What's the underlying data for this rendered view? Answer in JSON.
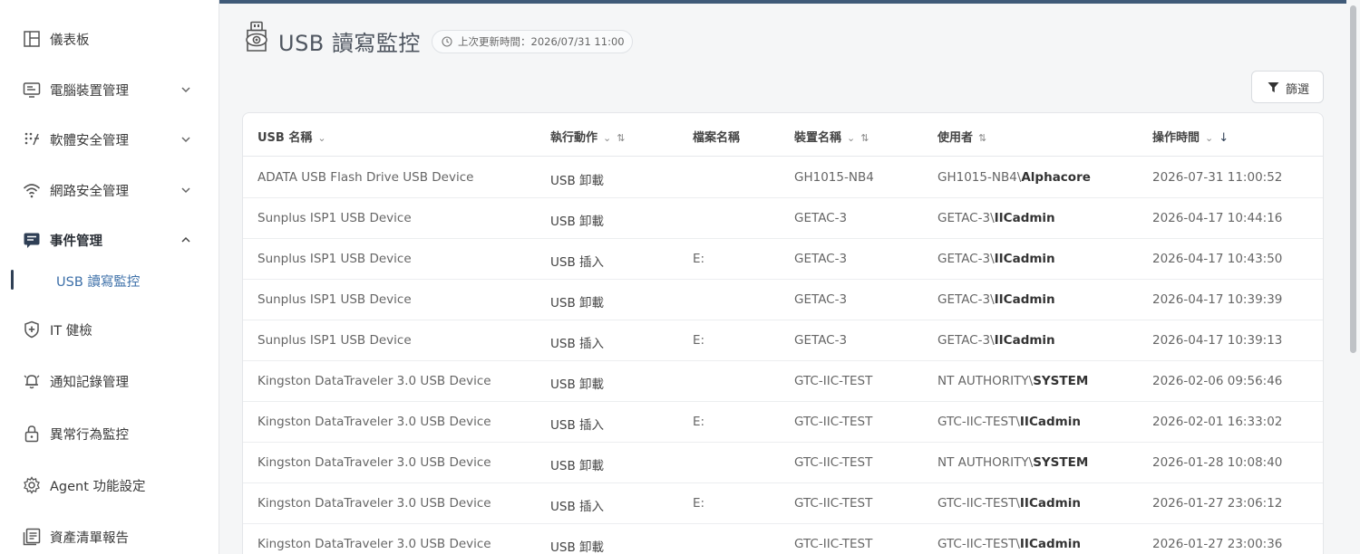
{
  "sidebar": {
    "items": [
      {
        "label": "儀表板",
        "icon": "layout-icon"
      },
      {
        "label": "電腦裝置管理",
        "icon": "monitor-icon"
      },
      {
        "label": "軟體安全管理",
        "icon": "grid-dots-icon"
      },
      {
        "label": "網路安全管理",
        "icon": "wifi-icon"
      },
      {
        "label": "事件管理",
        "icon": "event-list-icon"
      },
      {
        "label": "IT 健檢",
        "icon": "shield-plus-icon"
      },
      {
        "label": "通知記錄管理",
        "icon": "bell-icon"
      },
      {
        "label": "異常行為監控",
        "icon": "lock-icon"
      },
      {
        "label": "Agent 功能設定",
        "icon": "gear-icon"
      },
      {
        "label": "資產清單報告",
        "icon": "report-icon"
      }
    ],
    "sub_item": {
      "label": "USB 讀寫監控"
    }
  },
  "header": {
    "title": "USB 讀寫監控",
    "updated": "上次更新時間：2026/07/31 11:00",
    "filter_label": "篩選"
  },
  "table": {
    "columns": [
      "USB 名稱",
      "執行動作",
      "檔案名稱",
      "裝置名稱",
      "使用者",
      "操作時間"
    ],
    "rows": [
      {
        "usb": "ADATA USB Flash Drive USB Device",
        "action": "USB 卸載",
        "file": "",
        "device": "GH1015-NB4",
        "user_prefix": "GH1015-NB4\\",
        "user_name": "Alphacore",
        "time": "2026-07-31 11:00:52"
      },
      {
        "usb": "Sunplus ISP1 USB Device",
        "action": "USB 卸載",
        "file": "",
        "device": "GETAC-3",
        "user_prefix": "GETAC-3\\",
        "user_name": "IICadmin",
        "time": "2026-04-17 10:44:16"
      },
      {
        "usb": "Sunplus ISP1 USB Device",
        "action": "USB 插入",
        "file": "E:",
        "device": "GETAC-3",
        "user_prefix": "GETAC-3\\",
        "user_name": "IICadmin",
        "time": "2026-04-17 10:43:50"
      },
      {
        "usb": "Sunplus ISP1 USB Device",
        "action": "USB 卸載",
        "file": "",
        "device": "GETAC-3",
        "user_prefix": "GETAC-3\\",
        "user_name": "IICadmin",
        "time": "2026-04-17 10:39:39"
      },
      {
        "usb": "Sunplus ISP1 USB Device",
        "action": "USB 插入",
        "file": "E:",
        "device": "GETAC-3",
        "user_prefix": "GETAC-3\\",
        "user_name": "IICadmin",
        "time": "2026-04-17 10:39:13"
      },
      {
        "usb": "Kingston DataTraveler 3.0 USB Device",
        "action": "USB 卸載",
        "file": "",
        "device": "GTC-IIC-TEST",
        "user_prefix": "NT AUTHORITY\\",
        "user_name": "SYSTEM",
        "time": "2026-02-06 09:56:46"
      },
      {
        "usb": "Kingston DataTraveler 3.0 USB Device",
        "action": "USB 插入",
        "file": "E:",
        "device": "GTC-IIC-TEST",
        "user_prefix": "GTC-IIC-TEST\\",
        "user_name": "IICadmin",
        "time": "2026-02-01 16:33:02"
      },
      {
        "usb": "Kingston DataTraveler 3.0 USB Device",
        "action": "USB 卸載",
        "file": "",
        "device": "GTC-IIC-TEST",
        "user_prefix": "NT AUTHORITY\\",
        "user_name": "SYSTEM",
        "time": "2026-01-28 10:08:40"
      },
      {
        "usb": "Kingston DataTraveler 3.0 USB Device",
        "action": "USB 插入",
        "file": "E:",
        "device": "GTC-IIC-TEST",
        "user_prefix": "GTC-IIC-TEST\\",
        "user_name": "IICadmin",
        "time": "2026-01-27 23:06:12"
      },
      {
        "usb": "Kingston DataTraveler 3.0 USB Device",
        "action": "USB 卸載",
        "file": "",
        "device": "GTC-IIC-TEST",
        "user_prefix": "GTC-IIC-TEST\\",
        "user_name": "IICadmin",
        "time": "2026-01-27 23:00:36"
      }
    ]
  },
  "colors": {
    "accent": "#3f5a78",
    "link": "#3c6fa8"
  }
}
